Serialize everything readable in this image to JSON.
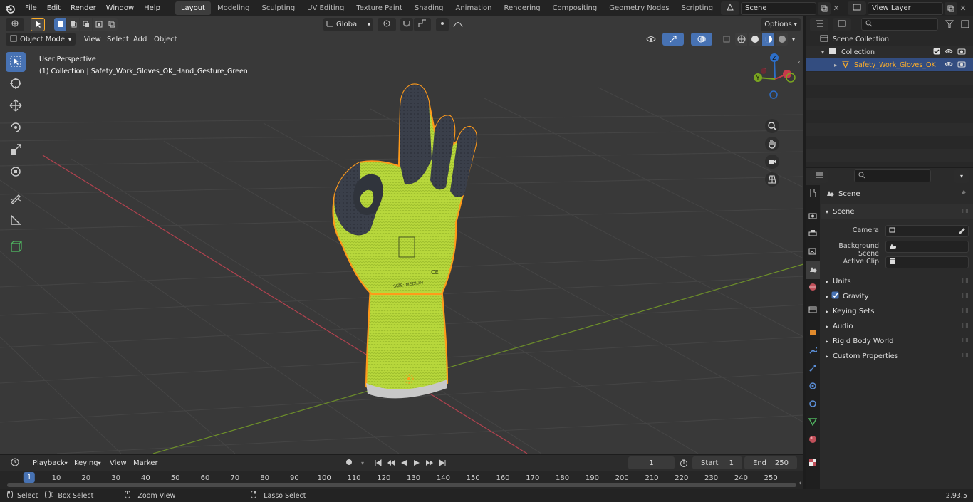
{
  "topbar": {
    "menus": [
      "File",
      "Edit",
      "Render",
      "Window",
      "Help"
    ],
    "workspaces": [
      {
        "label": "Layout",
        "active": true
      },
      {
        "label": "Modeling",
        "active": false
      },
      {
        "label": "Sculpting",
        "active": false
      },
      {
        "label": "UV Editing",
        "active": false
      },
      {
        "label": "Texture Paint",
        "active": false
      },
      {
        "label": "Shading",
        "active": false
      },
      {
        "label": "Animation",
        "active": false
      },
      {
        "label": "Rendering",
        "active": false
      },
      {
        "label": "Compositing",
        "active": false
      },
      {
        "label": "Geometry Nodes",
        "active": false
      },
      {
        "label": "Scripting",
        "active": false
      }
    ],
    "add_workspace": "+",
    "scene_name": "Scene",
    "view_layer_name": "View Layer"
  },
  "viewport": {
    "mode": "Object Mode",
    "menus": [
      "View",
      "Select",
      "Add",
      "Object"
    ],
    "transform_orientation": "Global",
    "options_label": "Options",
    "overlay_title": "User Perspective",
    "overlay_subtitle": "(1) Collection | Safety_Work_Gloves_OK_Hand_Gesture_Green",
    "gizmo_axes": {
      "z": "Z",
      "y": "Y",
      "x": "X"
    },
    "glove_label": "SIZE: MEDIUM",
    "glove_badge": "CE"
  },
  "outliner": {
    "rows": [
      {
        "label": "Scene Collection"
      },
      {
        "label": "Collection"
      },
      {
        "label": "Safety_Work_Gloves_OK"
      }
    ]
  },
  "properties": {
    "context": "Scene",
    "panel_scene": "Scene",
    "camera_label": "Camera",
    "background_scene_label": "Background Scene",
    "active_clip_label": "Active Clip",
    "panels": [
      "Units",
      "Gravity",
      "Keying Sets",
      "Audio",
      "Rigid Body World",
      "Custom Properties"
    ],
    "gravity_checked": true
  },
  "timeline": {
    "menus": [
      "Playback",
      "Keying",
      "View",
      "Marker"
    ],
    "current_frame": "1",
    "start_label": "Start",
    "start_value": "1",
    "end_label": "End",
    "end_value": "250",
    "ticks": [
      "1",
      "10",
      "20",
      "30",
      "40",
      "50",
      "60",
      "70",
      "80",
      "90",
      "100",
      "110",
      "120",
      "130",
      "140",
      "150",
      "160",
      "170",
      "180",
      "190",
      "200",
      "210",
      "220",
      "230",
      "240",
      "250"
    ]
  },
  "statusbar": {
    "select": "Select",
    "box_select": "Box Select",
    "zoom_view": "Zoom View",
    "lasso_select": "Lasso Select",
    "version": "2.93.5"
  },
  "colors": {
    "accent_blue": "#4772b3",
    "selection_orange": "#ffaf29",
    "glove_green": "#b5d63a"
  }
}
